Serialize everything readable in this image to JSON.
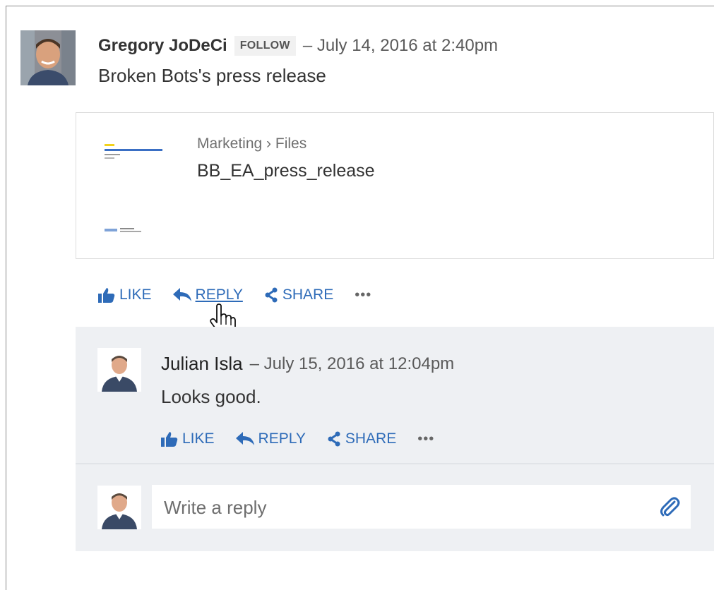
{
  "post": {
    "author": "Gregory JoDeCi",
    "follow_label": "FOLLOW",
    "timestamp": "– July 14, 2016 at 2:40pm",
    "text": "Broken Bots's press release",
    "attachment": {
      "path": "Marketing › Files",
      "file_name": "BB_EA_press_release"
    },
    "actions": {
      "like": "LIKE",
      "reply": "REPLY",
      "share": "SHARE",
      "more": "•••"
    }
  },
  "reply": {
    "author": "Julian Isla",
    "timestamp": "– July 15, 2016 at 12:04pm",
    "text": "Looks good.",
    "actions": {
      "like": "LIKE",
      "reply": "REPLY",
      "share": "SHARE",
      "more": "•••"
    }
  },
  "composer": {
    "placeholder": "Write a reply",
    "value": ""
  },
  "icons": {
    "like": "thumbs-up-icon",
    "reply": "reply-arrow-icon",
    "share": "share-icon",
    "more": "more-icon",
    "attach": "paperclip-icon",
    "cursor": "hand-pointer-icon"
  },
  "colors": {
    "accent": "#2e6bb8",
    "reply_background": "#eef0f3",
    "follow_badge_bg": "#f1f1f1"
  }
}
